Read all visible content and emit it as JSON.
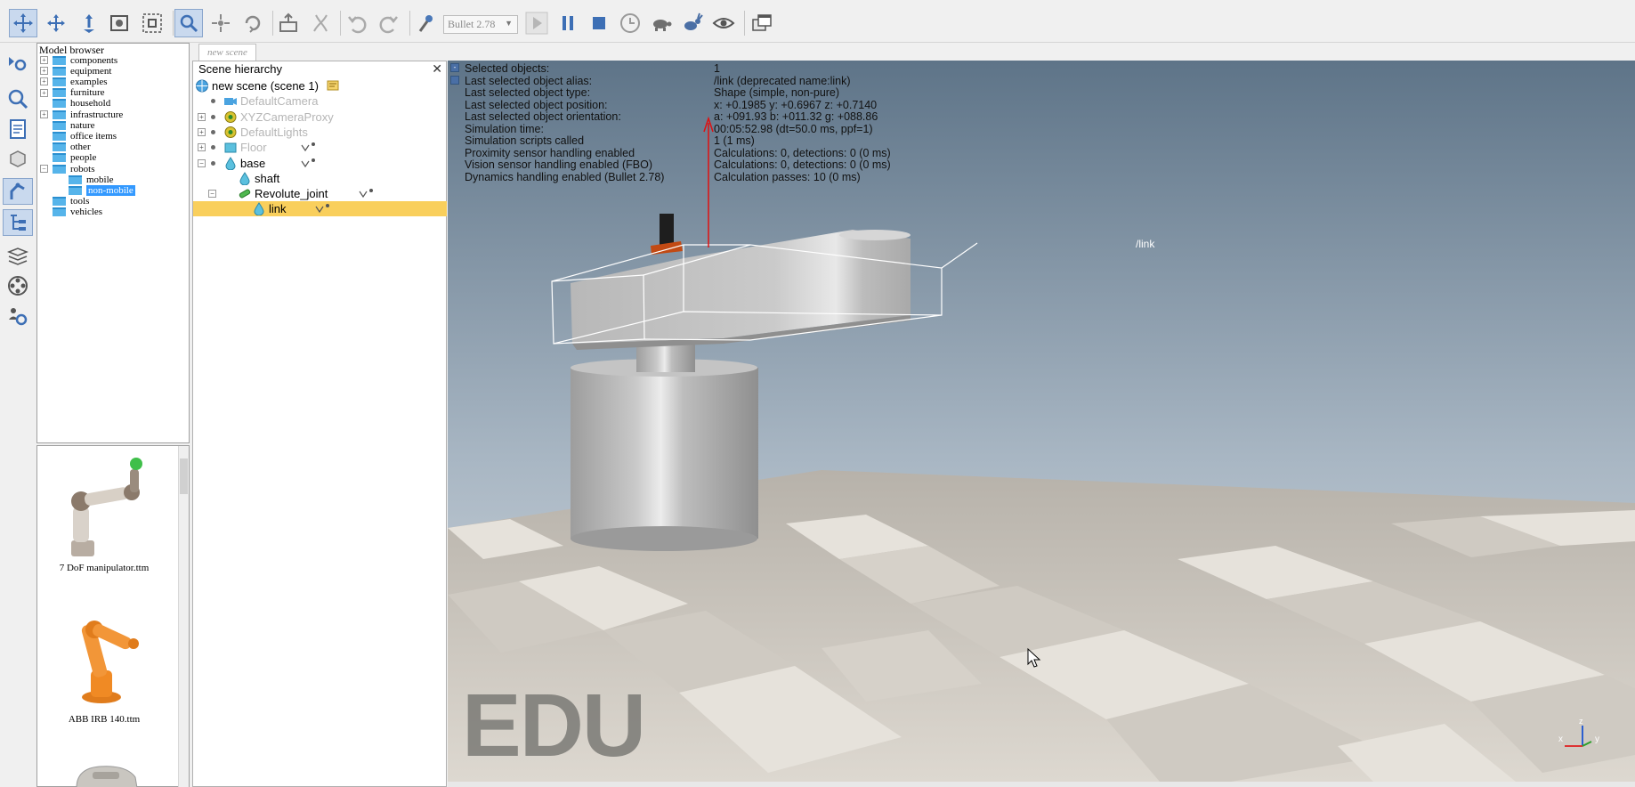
{
  "toolbar": {
    "tools": [
      {
        "name": "object-shift",
        "icon": "move-arrows-icon"
      },
      {
        "name": "object-rotate",
        "icon": "rotate-icon"
      },
      {
        "name": "camera-pan",
        "icon": "camera-pan-icon"
      },
      {
        "name": "camera-fit",
        "icon": "camera-fit-icon"
      },
      {
        "name": "camera-zoom",
        "icon": "zoom-region-icon"
      },
      {
        "name": "click-select",
        "icon": "select-icon"
      },
      {
        "name": "object-translate",
        "icon": "translate-icon"
      },
      {
        "name": "object-rotate-2",
        "icon": "rotate-obj-icon"
      },
      {
        "name": "assemble",
        "icon": "assemble-icon"
      },
      {
        "name": "transfer-dna",
        "icon": "dna-icon"
      },
      {
        "name": "undo",
        "icon": "undo-icon"
      },
      {
        "name": "redo",
        "icon": "redo-icon"
      },
      {
        "name": "dynamics-settings",
        "icon": "dynamics-icon"
      }
    ],
    "engine": "Bullet 2.78",
    "sim_controls": [
      {
        "name": "start-simulation",
        "icon": "play-icon"
      },
      {
        "name": "pause-simulation",
        "icon": "pause-icon"
      },
      {
        "name": "stop-simulation",
        "icon": "stop-icon"
      },
      {
        "name": "realtime-mode",
        "icon": "clock-icon"
      },
      {
        "name": "slow-down",
        "icon": "turtle-icon"
      },
      {
        "name": "speed-up",
        "icon": "rabbit-icon"
      },
      {
        "name": "toggle-visualization",
        "icon": "eye-icon"
      },
      {
        "name": "scene-views",
        "icon": "windows-icon"
      }
    ]
  },
  "model_browser": {
    "title": "Model browser",
    "items": [
      {
        "label": "components",
        "expandable": true,
        "expanded": false,
        "indent": 0
      },
      {
        "label": "equipment",
        "expandable": true,
        "expanded": false,
        "indent": 0
      },
      {
        "label": "examples",
        "expandable": true,
        "expanded": false,
        "indent": 0
      },
      {
        "label": "furniture",
        "expandable": true,
        "expanded": false,
        "indent": 0
      },
      {
        "label": "household",
        "expandable": false,
        "indent": 0
      },
      {
        "label": "infrastructure",
        "expandable": true,
        "expanded": false,
        "indent": 0
      },
      {
        "label": "nature",
        "expandable": false,
        "indent": 0
      },
      {
        "label": "office items",
        "expandable": false,
        "indent": 0
      },
      {
        "label": "other",
        "expandable": false,
        "indent": 0
      },
      {
        "label": "people",
        "expandable": false,
        "indent": 0
      },
      {
        "label": "robots",
        "expandable": true,
        "expanded": true,
        "indent": 0
      },
      {
        "label": "mobile",
        "expandable": false,
        "indent": 1
      },
      {
        "label": "non-mobile",
        "expandable": false,
        "indent": 1,
        "selected": true
      },
      {
        "label": "tools",
        "expandable": false,
        "indent": 0
      },
      {
        "label": "vehicles",
        "expandable": false,
        "indent": 0
      }
    ],
    "thumbnails": [
      {
        "caption": "7 DoF manipulator.ttm"
      },
      {
        "caption": "ABB IRB 140.ttm"
      }
    ]
  },
  "tabs": [
    {
      "label": "new scene"
    }
  ],
  "scene_hierarchy": {
    "title": "Scene hierarchy",
    "close": "✕",
    "rows": [
      {
        "label": "new scene (scene 1)",
        "icon": "globe-icon",
        "indent": 0,
        "dim": false,
        "expandable": false
      },
      {
        "label": "DefaultCamera",
        "icon": "camera-icon",
        "indent": 1,
        "dim": true,
        "expandable": false
      },
      {
        "label": "XYZCameraProxy",
        "icon": "dummy-icon",
        "indent": 1,
        "dim": true,
        "expandable": true
      },
      {
        "label": "DefaultLights",
        "icon": "dummy-icon",
        "indent": 1,
        "dim": true,
        "expandable": true
      },
      {
        "label": "Floor",
        "icon": "shape-compound-icon",
        "indent": 1,
        "dim": true,
        "expandable": true,
        "script": true
      },
      {
        "label": "base",
        "icon": "shape-icon",
        "indent": 1,
        "dim": false,
        "expandable": true,
        "expanded": true,
        "script": true
      },
      {
        "label": "shaft",
        "icon": "shape-icon",
        "indent": 2,
        "dim": false,
        "expandable": false
      },
      {
        "label": "Revolute_joint",
        "icon": "joint-icon",
        "indent": 2,
        "dim": false,
        "expandable": true,
        "expanded": true,
        "script": true
      },
      {
        "label": "link",
        "icon": "shape-icon",
        "indent": 3,
        "dim": false,
        "expandable": false,
        "selected": true,
        "script": true
      }
    ]
  },
  "info_panel": {
    "rows": [
      {
        "key": "Selected objects:",
        "value": "1"
      },
      {
        "key": "Last selected object alias:",
        "value": "/link    (deprecated name:link)"
      },
      {
        "key": "Last selected object type:",
        "value": "Shape (simple, non-pure)"
      },
      {
        "key": "Last selected object position:",
        "value": "x: +0.1985    y: +0.6967    z: +0.7140"
      },
      {
        "key": "Last selected object orientation:",
        "value": "a: +091.93    b: +011.32    g: +088.86"
      },
      {
        "key": "Simulation time:",
        "value": "00:05:52.98 (dt=50.0 ms, ppf=1)"
      },
      {
        "key": "Simulation scripts called",
        "value": "1 (1 ms)"
      },
      {
        "key": "Proximity sensor handling enabled",
        "value": "Calculations: 0, detections: 0 (0 ms)"
      },
      {
        "key": "Vision sensor handling enabled (FBO)",
        "value": "Calculations: 0, detections: 0 (0 ms)"
      },
      {
        "key": "Dynamics handling enabled (Bullet 2.78)",
        "value": "Calculation passes: 10 (0 ms)"
      }
    ]
  },
  "viewport": {
    "object_label": "/link",
    "watermark": "EDU",
    "axes": {
      "x": "x",
      "y": "y",
      "z": "z"
    }
  },
  "colors": {
    "selection_highlight": "#f9cf5c",
    "tree_selection": "#3399ff",
    "sky_top": "#5e7488",
    "sky_bottom": "#c9d2da",
    "floor_light": "#e3dfd8",
    "floor_dark": "#c8c4bc"
  }
}
